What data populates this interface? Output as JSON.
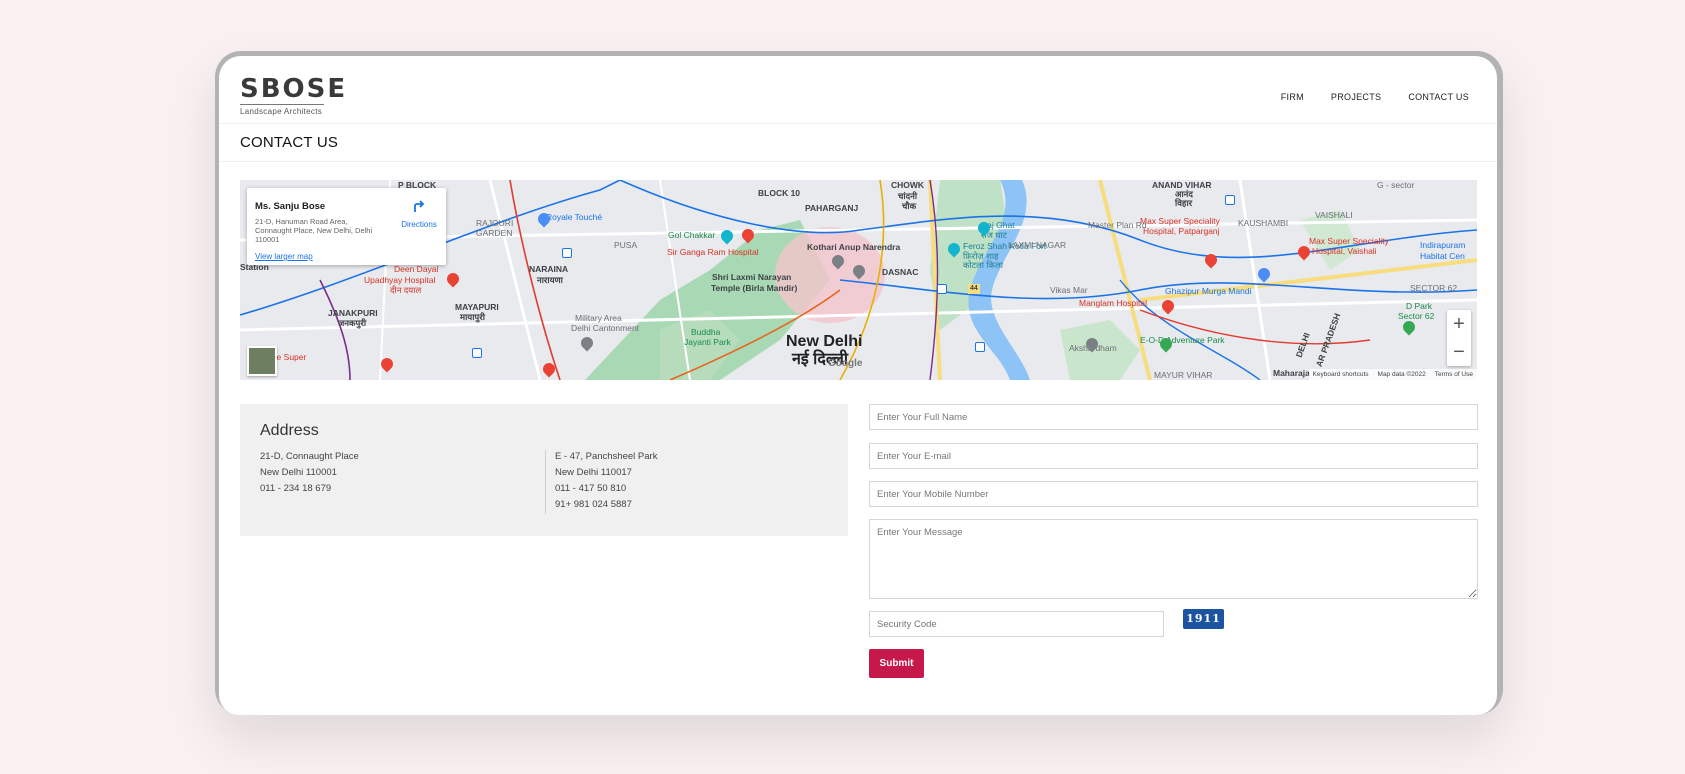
{
  "brand": {
    "name": "SBOSE",
    "tagline": "Landscape Architects"
  },
  "nav": {
    "items": [
      "FIRM",
      "PROJECTS",
      "CONTACT US"
    ]
  },
  "page": {
    "title": "CONTACT US"
  },
  "map": {
    "place_name": "Ms. Sanju Bose",
    "place_address": "21-D, Hanuman Road Area, Connaught Place, New Delhi, Delhi 110001",
    "directions_label": "Directions",
    "larger_map_label": "View larger map",
    "zoom_in": "+",
    "zoom_out": "−",
    "attribution": {
      "shortcuts": "Keyboard shortcuts",
      "data": "Map data ©2022",
      "terms": "Terms of Use"
    },
    "google": "Google",
    "labels": {
      "p_block": "P BLOCK",
      "rajouri": "RAJOURI",
      "rajouri2": "GARDEN",
      "royale": "Royale Touché",
      "pusa": "PUSA",
      "block10": "BLOCK 10",
      "paharganj": "PAHARGANJ",
      "chowk": "CHOWK",
      "chandni": "चांदनी",
      "chandni2": "चौक",
      "golchakkar": "Gol Chakkar",
      "sirganga": "Sir Ganga Ram Hospital",
      "rajghat": "Raj Ghat",
      "rajghat2": "राज घाट",
      "kotla": "Feroz Shah Kotla Fort",
      "kotla2": "फ़िरोज़ शाह",
      "kotla3": "कोटला किला",
      "kothari": "Kothari Anup Narendra",
      "dasnac": "DASNAC",
      "naraina": "NARAINA",
      "naraina2": "नारायणा",
      "deendayal": "Deen Dayal",
      "upadhyay": "Upadhyay Hospital",
      "upadhyay2": "दीन दयाल",
      "janakpuri": "JANAKPURI",
      "janakpuri2": "जनकपुरी",
      "mayapuri": "MAYAPURI",
      "mayapuri2": "मायापुरी",
      "military": "Military Area",
      "military2": "Delhi Cantonment",
      "laxmi": "Shri Laxmi Narayan",
      "laxmi2": "Temple (Birla Mandir)",
      "buddha": "Buddha",
      "buddha2": "Jayanti Park",
      "newdelhi": "New Delhi",
      "newdelhi2": "नई दिल्ली",
      "akshardham": "Akshardham",
      "anandvihar": "ANAND VIHAR",
      "anandvihar2": "आनंद",
      "anandvihar3": "विहार",
      "maxpatpar": "Max Super Speciality",
      "maxpatpar2": "Hospital, Patparganj",
      "maxvaishali": "Max Super Speciality",
      "maxvaishali2": "Hospital, Vaishali",
      "ghazipur": "Ghazipur Murga Mandi",
      "manglam": "Manglam Hospital",
      "eod": "E-O-D Adventure Park",
      "dpark": "D Park",
      "dpark2": "Sector 62",
      "indirapuram": "Indirapuram",
      "indirapuram2": "Habitat Cen",
      "maharaja": "Maharaja",
      "pradesh": "AR PRADESH",
      "delhi": "DELHI",
      "sector62": "SECTOR 62",
      "masterplan": "Master Plan Rd",
      "laxminagar": "LAXMI NAGAR",
      "kaushambi": "KAUSHAMBI",
      "vaishali": "VAISHALI",
      "mayurvihar": "MAYUR VIHAR",
      "vikasmarg": "Vikas Mar",
      "station": "Station",
      "hcare": "H",
      "hcare2": "are Super",
      "nh44": "44",
      "sectorg": "G - sector"
    }
  },
  "address": {
    "heading": "Address",
    "office1": [
      "21-D, Connaught Place",
      "New Delhi 110001",
      "011 - 234 18 679"
    ],
    "office2": [
      "E - 47, Panchsheel Park",
      "New Delhi 110017",
      "011 - 417 50 810",
      "91+ 981 024 5887"
    ]
  },
  "form": {
    "name_placeholder": "Enter Your Full Name",
    "email_placeholder": "Enter Your E-mail",
    "mobile_placeholder": "Enter Your Mobile Number",
    "message_placeholder": "Enter Your Message",
    "security_placeholder": "Security Code",
    "captcha_code": "1911",
    "submit_label": "Submit"
  }
}
